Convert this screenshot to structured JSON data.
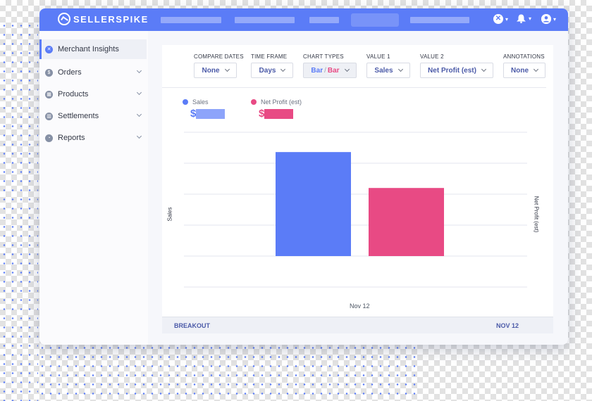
{
  "app": {
    "brand": "SELLERSPIKE",
    "colors": {
      "primary": "#5b7cf7",
      "sales": "#5b7cf7",
      "profit": "#e84a84",
      "sales_light": "#8da4fa"
    }
  },
  "topbar": {
    "icons": [
      {
        "name": "close-circle-icon",
        "glyph": "✕"
      },
      {
        "name": "bell-icon",
        "glyph": "🔔"
      },
      {
        "name": "user-icon",
        "glyph": "●"
      }
    ]
  },
  "sidebar": {
    "items": [
      {
        "label": "Merchant Insights",
        "icon": "✕",
        "active": true
      },
      {
        "label": "Orders",
        "icon": "$",
        "active": false
      },
      {
        "label": "Products",
        "icon": "▦",
        "active": false
      },
      {
        "label": "Settlements",
        "icon": "▥",
        "active": false
      },
      {
        "label": "Reports",
        "icon": "◔",
        "active": false
      }
    ]
  },
  "controls": {
    "compare_dates": {
      "label": "COMPARE DATES",
      "value": "None"
    },
    "time_frame": {
      "label": "TIME FRAME",
      "value": "Days"
    },
    "chart_types": {
      "label": "CHART TYPES",
      "value_a": "Bar",
      "sep": "/",
      "value_b": "Bar"
    },
    "value1": {
      "label": "VALUE 1",
      "value": "Sales"
    },
    "value2": {
      "label": "VALUE 2",
      "value": "Net Profit (est)"
    },
    "annotations": {
      "label": "ANNOTATIONS",
      "value": "None"
    }
  },
  "legend": {
    "sales": {
      "label": "Sales",
      "currency": "$"
    },
    "profit": {
      "label": "Net Profit (est)",
      "currency": "$"
    }
  },
  "chart_data": {
    "type": "bar",
    "categories": [
      "Nov 12"
    ],
    "series": [
      {
        "name": "Sales",
        "values": [
          0.84
        ]
      },
      {
        "name": "Net Profit (est)",
        "values": [
          0.55
        ]
      }
    ],
    "ylabel_left": "Sales",
    "ylabel_right": "Net Profit (est)",
    "ylim": [
      0,
      1
    ],
    "grid": true
  },
  "footer": {
    "breakout_label": "BREAKOUT",
    "date_label": "NOV 12"
  }
}
